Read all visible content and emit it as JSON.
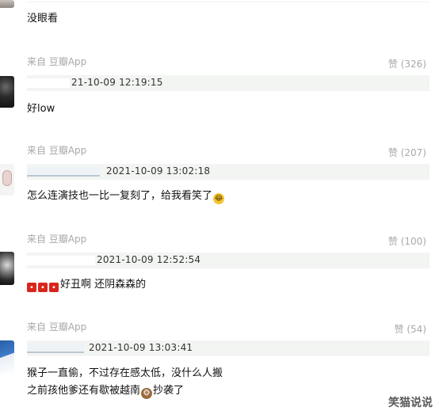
{
  "comments": [
    {
      "content": "没眼看",
      "source": "来自 豆瓣App",
      "likes": "赞 (326)"
    },
    {
      "timestamp": "21-10-09 12:19:15",
      "content": "好low",
      "source": "来自 豆瓣App",
      "likes": "赞 (207)"
    },
    {
      "timestamp": "2021-10-09 13:02:18",
      "content": "怎么连演技也一比一复刻了，给我看笑了",
      "emoji": "laughing-emoji",
      "source": "来自 豆瓣App",
      "likes": "赞 (100)"
    },
    {
      "timestamp": "2021-10-09 12:52:54",
      "badge_count": 3,
      "content": "好丑啊 还阴森森的",
      "source": "来自 豆瓣App",
      "likes": "赞 (54)"
    },
    {
      "timestamp": "2021-10-09 13:03:41",
      "content_line1": "猴子一直偷，不过存在感太低，没什么人搬",
      "content_line2_a": "之前孩他爹还有歇被越南",
      "emoji": "monkey-emoji",
      "content_line2_b": "抄袭了"
    }
  ],
  "watermark": "笑猫说说",
  "colors": {
    "meta_bar": "#f3f5f3",
    "muted_text": "#a8a8a8",
    "badge_red": "#d9261c"
  }
}
